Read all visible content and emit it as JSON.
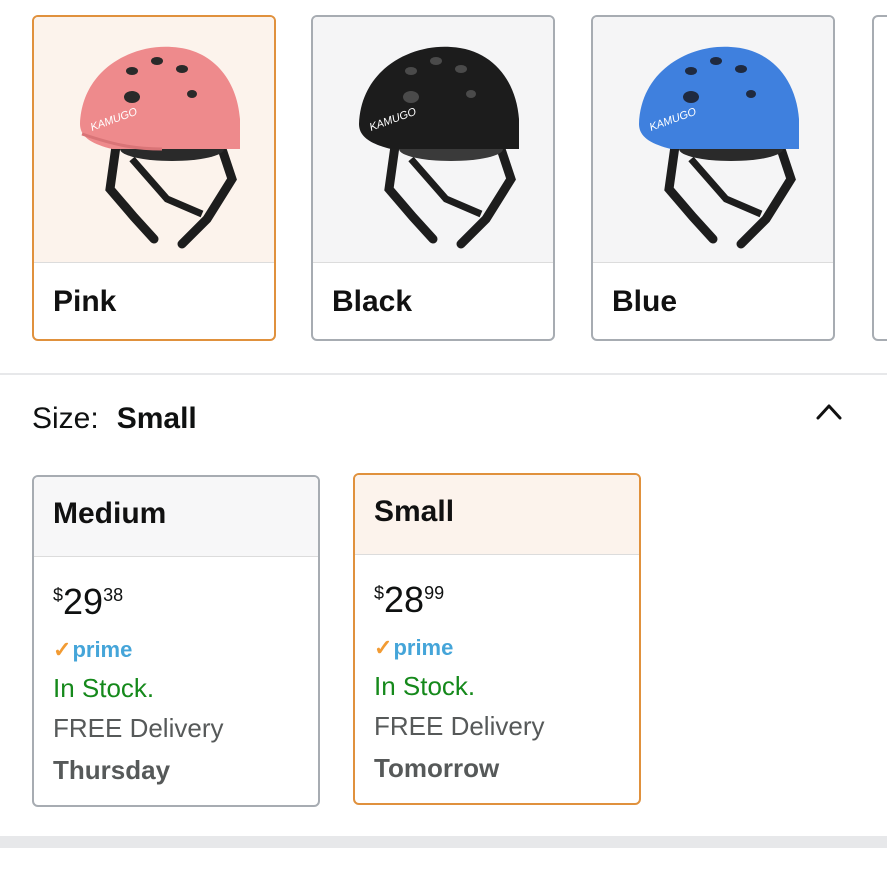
{
  "colors": {
    "options": [
      {
        "label": "Pink",
        "helmet_color": "#ee8a8c",
        "logo": "KAMUGO"
      },
      {
        "label": "Black",
        "helmet_color": "#1c1c1c",
        "logo": "KAMUGO"
      },
      {
        "label": "Blue",
        "helmet_color": "#3f80de",
        "logo": "KAMUGO"
      }
    ],
    "selected": "Pink"
  },
  "size": {
    "label": "Size:",
    "selected_value": "Small",
    "options": [
      {
        "name": "Medium",
        "price_symbol": "$",
        "price_whole": "29",
        "price_fraction": "38",
        "prime": "prime",
        "stock": "In Stock.",
        "delivery": "FREE Delivery",
        "delivery_day": "Thursday"
      },
      {
        "name": "Small",
        "price_symbol": "$",
        "price_whole": "28",
        "price_fraction": "99",
        "prime": "prime",
        "stock": "In Stock.",
        "delivery": "FREE Delivery",
        "delivery_day": "Tomorrow"
      }
    ]
  },
  "theme": {
    "selected_border": "#e0913d",
    "in_stock_color": "#15891b",
    "prime_color": "#45a5d9"
  }
}
